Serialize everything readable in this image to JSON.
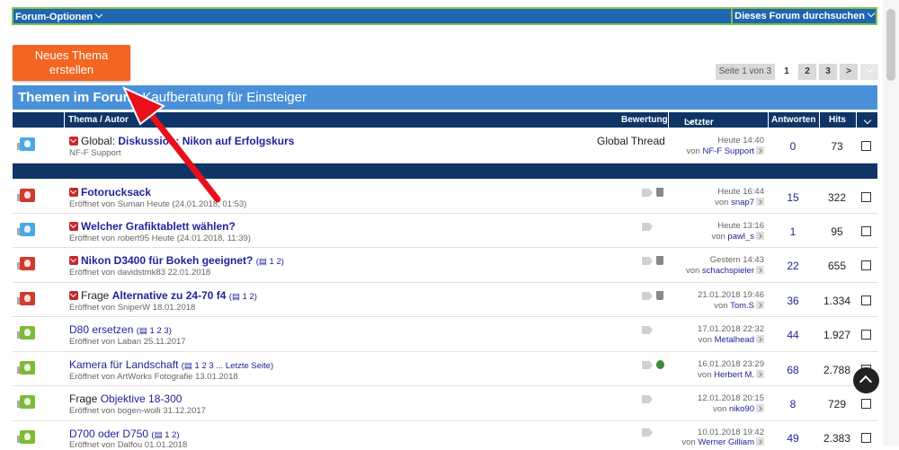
{
  "topbar": {
    "forum_options": "Forum-Optionen",
    "search_forum": "Dieses Forum durchsuchen"
  },
  "new_thread": {
    "line1": "Neues Thema",
    "line2": "erstellen"
  },
  "pager": {
    "info": "Seite 1 von 3",
    "pages": [
      "1",
      "2",
      "3"
    ],
    "next": ">"
  },
  "header": {
    "prefix": "Themen im Forum",
    "forum": ": Kaufberatung für Einsteiger"
  },
  "columns": {
    "thread": "Thema / Autor",
    "rating": "Bewertung",
    "last_post": "Letzter Beitrag",
    "replies": "Antworten",
    "hits": "Hits"
  },
  "colors": {
    "accent": "#f26522",
    "header_blue": "#4a90d9",
    "dark_blue": "#0f3566",
    "link": "#22229c"
  },
  "threads": [
    {
      "icon": "blue",
      "prefix": "Global:",
      "title": "Diskussion: Nikon auf Erfolgskurs",
      "meta": "NF-F Support",
      "tag": "Global Thread",
      "last_time": "Heute 14:40",
      "last_by": "von",
      "last_user": "NF-F Support",
      "replies": "0",
      "hits": "73"
    },
    {
      "icon": "red",
      "prefix": "",
      "title": "Fotorucksack",
      "meta": "Eröffnet von Suman Heute (24.01.2018, 01:53)",
      "last_time": "Heute 16:44",
      "last_by": "von",
      "last_user": "snap7",
      "replies": "15",
      "hits": "322"
    },
    {
      "icon": "blue",
      "prefix": "",
      "title": "Welcher Grafiktablett wählen?",
      "meta": "Eröffnet von robert95 Heute (24.01.2018, 11:39)",
      "last_time": "Heute 13:16",
      "last_by": "von",
      "last_user": "pawl_s",
      "replies": "1",
      "hits": "95"
    },
    {
      "icon": "red",
      "prefix": "",
      "title": "Nikon D3400 für Bokeh geeignet?",
      "pages": "1 2",
      "meta": "Eröffnet von davidstmk83 22.01.2018",
      "last_time": "Gestern 14:43",
      "last_by": "von",
      "last_user": "schachspieler",
      "replies": "22",
      "hits": "655"
    },
    {
      "icon": "red",
      "prefix": "Frage",
      "title": "Alternative zu 24-70 f4",
      "pages": "1 2",
      "meta": "Eröffnet von SniperW 18.01.2018",
      "last_time": "21.01.2018 19:46",
      "last_by": "von",
      "last_user": "Tom.S",
      "replies": "36",
      "hits": "1.334"
    },
    {
      "icon": "green",
      "prefix": "",
      "title": "D80 ersetzen",
      "pages": "1 2 3",
      "meta": "Eröffnet von Laban 25.11.2017",
      "last_time": "17.01.2018 22:32",
      "last_by": "von",
      "last_user": "Metalhead",
      "replies": "44",
      "hits": "1.927"
    },
    {
      "icon": "green",
      "prefix": "",
      "title": "Kamera für Landschaft",
      "pages": "1 2 3 ... Letzte Seite",
      "meta": "Eröffnet von ArtWorks Fotografie 13.01.2018",
      "last_time": "16.01.2018 23:29",
      "last_by": "von",
      "last_user": "Herbert M.",
      "replies": "68",
      "hits": "2.788"
    },
    {
      "icon": "green",
      "prefix": "Frage",
      "title": "Objektive 18-300",
      "meta": "Eröffnet von bogen-wolli 31.12.2017",
      "last_time": "12.01.2018 20:15",
      "last_by": "von",
      "last_user": "niko90",
      "replies": "8",
      "hits": "729"
    },
    {
      "icon": "green",
      "prefix": "",
      "title": "D700 oder D750",
      "pages": "1 2",
      "meta": "Eröffnet von Dalfou 01.01.2018",
      "last_time": "10.01.2018 19:42",
      "last_by": "von",
      "last_user": "Werner Gilliam",
      "replies": "49",
      "hits": "2.383"
    }
  ]
}
